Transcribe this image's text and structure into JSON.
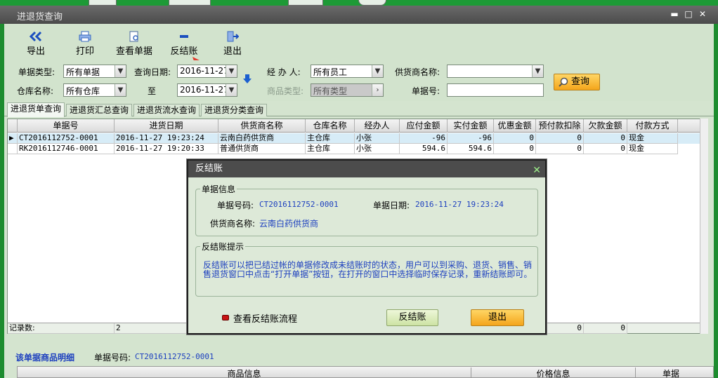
{
  "window": {
    "title": "进退货查询"
  },
  "toolbar": {
    "export": "导出",
    "print": "打印",
    "view_doc": "查看单据",
    "unsettle": "反结账",
    "exit": "退出"
  },
  "filters": {
    "doc_type_label": "单据类型:",
    "doc_type_value": "所有单据",
    "date_label": "查询日期:",
    "date_from": "2016-11-27",
    "date_to": "2016-11-27",
    "to_label": "至",
    "handler_label": "经 办 人:",
    "handler_value": "所有员工",
    "supplier_label": "供货商名称:",
    "supplier_value": "",
    "warehouse_label": "仓库名称:",
    "warehouse_value": "所有仓库",
    "category_label": "商品类型:",
    "category_value": "所有类型",
    "doc_no_label": "单据号:",
    "doc_no_value": "",
    "query_button": "查询"
  },
  "tabs": [
    "进退货单查询",
    "进退货汇总查询",
    "进退货流水查询",
    "进退货分类查询"
  ],
  "grid": {
    "columns": [
      "单据号",
      "进货日期",
      "供货商名称",
      "仓库名称",
      "经办人",
      "应付金额",
      "实付金额",
      "优惠金额",
      "预付款扣除",
      "欠款金额",
      "付款方式"
    ],
    "rows": [
      [
        "CT2016112752-0001",
        "2016-11-27 19:23:24",
        "云南白药供货商",
        "主仓库",
        "小张",
        "-96",
        "-96",
        "0",
        "0",
        "0",
        "现金"
      ],
      [
        "RK2016112746-0001",
        "2016-11-27 19:20:33",
        "普通供货商",
        "主仓库",
        "小张",
        "594.6",
        "594.6",
        "0",
        "0",
        "0",
        "现金"
      ]
    ],
    "footer": {
      "label": "记录数:",
      "count": "2",
      "v1": "0",
      "v2": "0"
    }
  },
  "detail": {
    "title": "该单据商品明细",
    "doc_no_label": "单据号码:",
    "doc_no_value": "CT2016112752-0001",
    "col_goods": "商品信息",
    "col_price": "价格信息",
    "col_doc": "单据"
  },
  "dialog": {
    "title": "反结账",
    "group1_title": "单据信息",
    "doc_no_label": "单据号码:",
    "doc_no_value": "CT2016112752-0001",
    "doc_date_label": "单据日期:",
    "doc_date_value": "2016-11-27 19:23:24",
    "supplier_label": "供货商名称:",
    "supplier_value": "云南白药供货商",
    "group2_title": "反结账提示",
    "hint_text": "反结账可以把已结过帐的单据修改成未结账时的状态，用户可以到采购、退货、销售、销售退货窗口中点击“打开单据”按钮，在打开的窗口中选择临时保存记录，重新结账即可。",
    "view_flow": "查看反结账流程",
    "unsettle_button": "反结账",
    "exit_button": "退出"
  },
  "colors": {
    "accent_green": "#1d8c2f",
    "orange_button": "#f4a51b",
    "link_blue": "#1c3fbf"
  }
}
